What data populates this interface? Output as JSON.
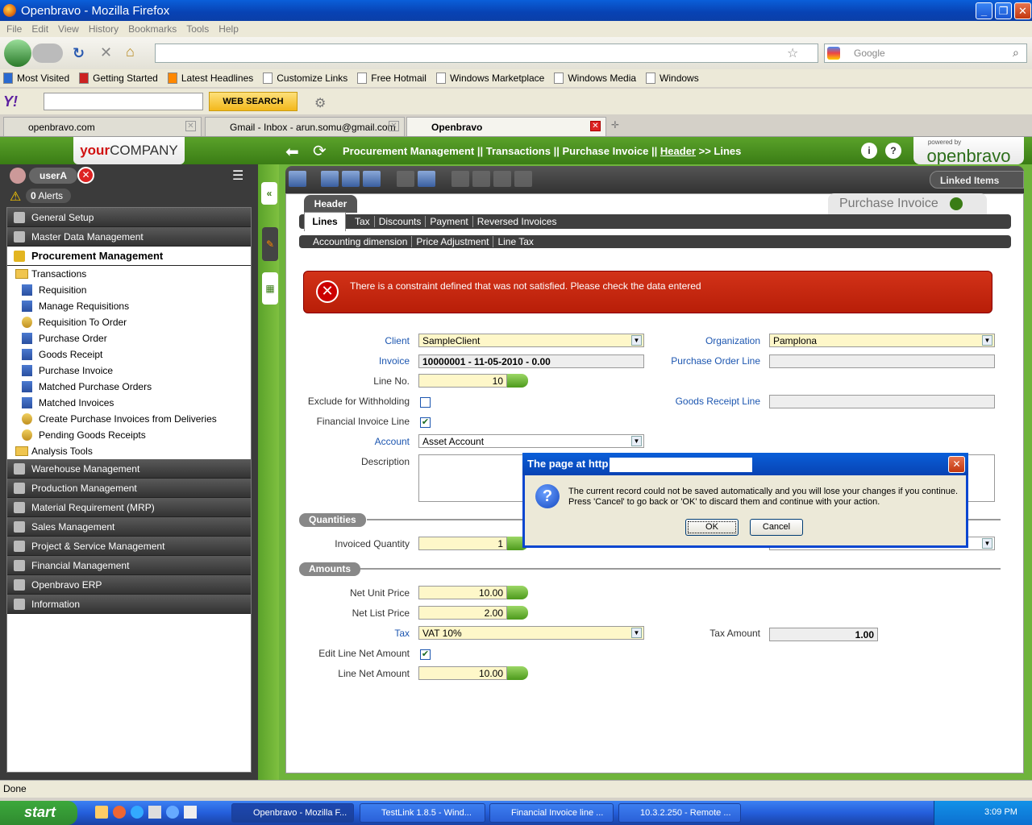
{
  "window": {
    "title": "Openbravo - Mozilla Firefox"
  },
  "menubar": [
    "File",
    "Edit",
    "View",
    "History",
    "Bookmarks",
    "Tools",
    "Help"
  ],
  "search": {
    "placeholder": "Google"
  },
  "bookmarks": [
    "Most Visited",
    "Getting Started",
    "Latest Headlines",
    "Customize Links",
    "Free Hotmail",
    "Windows Marketplace",
    "Windows Media",
    "Windows"
  ],
  "yahoo": {
    "logo": "Y!",
    "button": "WEB SEARCH"
  },
  "tabs": [
    {
      "label": "openbravo.com"
    },
    {
      "label": "Gmail - Inbox - arun.somu@gmail.com"
    },
    {
      "label": "Openbravo"
    }
  ],
  "app": {
    "company_your": "your",
    "company_name": "COMPANY",
    "breadcrumb_path": "Procurement Management || Transactions || Purchase Invoice ||",
    "breadcrumb_header": "Header",
    "breadcrumb_tail": ">> Lines",
    "brand_small": "powered by",
    "brand": "openbravo"
  },
  "user": {
    "name": "userA",
    "alerts_count": "0",
    "alerts_label": "Alerts"
  },
  "menu": {
    "general_setup": "General Setup",
    "master_data": "Master Data Management",
    "procurement": "Procurement Management",
    "transactions": "Transactions",
    "items": [
      "Requisition",
      "Manage Requisitions",
      "Requisition To Order",
      "Purchase Order",
      "Goods Receipt",
      "Purchase Invoice",
      "Matched Purchase Orders",
      "Matched Invoices",
      "Create Purchase Invoices from Deliveries",
      "Pending Goods Receipts"
    ],
    "analysis_tools": "Analysis Tools",
    "bottom": [
      "Warehouse Management",
      "Production Management",
      "Material Requirement (MRP)",
      "Sales Management",
      "Project & Service Management",
      "Financial Management",
      "Openbravo ERP",
      "Information"
    ]
  },
  "toolbar": {
    "linked_items": "Linked Items"
  },
  "window_title": "Purchase Invoice",
  "header_tab": "Header",
  "subtabs1": [
    "Lines",
    "Tax",
    "Discounts",
    "Payment",
    "Reversed Invoices"
  ],
  "subtabs2": [
    "Accounting dimension",
    "Price Adjustment",
    "Line Tax"
  ],
  "error": {
    "message": "There is a constraint defined that was not satisfied. Please check the data entered"
  },
  "form": {
    "client_label": "Client",
    "client_value": "SampleClient",
    "org_label": "Organization",
    "org_value": "Pamplona",
    "invoice_label": "Invoice",
    "invoice_value": "10000001 - 11-05-2010 - 0.00",
    "po_line_label": "Purchase Order Line",
    "line_no_label": "Line No.",
    "line_no_value": "10",
    "exclude_label": "Exclude for Withholding",
    "goods_receipt_label": "Goods Receipt Line",
    "fin_invoice_label": "Financial Invoice Line",
    "account_label": "Account",
    "account_value": "Asset Account",
    "description_label": "Description",
    "quantities_section": "Quantities",
    "invoiced_qty_label": "Invoiced Quantity",
    "invoiced_qty_value": "1",
    "amounts_section": "Amounts",
    "net_unit_label": "Net Unit Price",
    "net_unit_value": "10.00",
    "net_list_label": "Net List Price",
    "net_list_value": "2.00",
    "tax_label": "Tax",
    "tax_value": "VAT 10%",
    "tax_amount_label": "Tax Amount",
    "tax_amount_value": "1.00",
    "edit_line_net_label": "Edit Line Net Amount",
    "line_net_label": "Line Net Amount",
    "line_net_value": "10.00"
  },
  "dialog": {
    "title": "The page at http",
    "message_line1": "The current record could not be saved automatically and you will lose your changes if you continue.",
    "message_line2": "Press 'Cancel' to go back or 'OK' to discard them and continue with your action.",
    "ok": "OK",
    "cancel": "Cancel"
  },
  "status": {
    "text": "Done"
  },
  "taskbar": {
    "start": "start",
    "tasks": [
      "Openbravo - Mozilla F...",
      "TestLink 1.8.5 - Wind...",
      "Financial Invoice line ...",
      "10.3.2.250 - Remote ..."
    ],
    "clock": "3:09 PM"
  }
}
